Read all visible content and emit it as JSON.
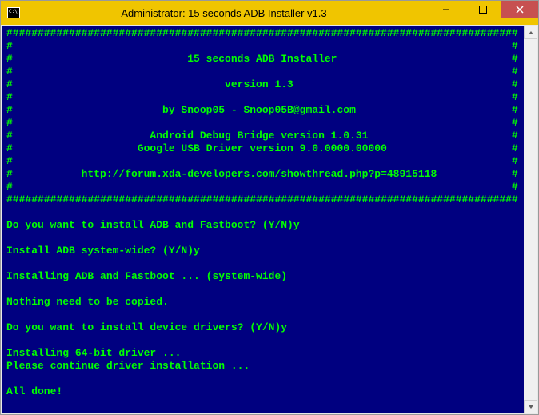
{
  "window": {
    "title": "Administrator:  15 seconds ADB Installer v1.3"
  },
  "header": {
    "hash_full": "##################################################################################",
    "hash_side": "#",
    "line_title": "15 seconds ADB Installer",
    "line_version": "version 1.3",
    "line_credit": "by Snoop05 - Snoop05B@gmail.com",
    "line_adb": "Android Debug Bridge version 1.0.31",
    "line_usb": "Google USB Driver version 9.0.0000.00000",
    "line_url": "http://forum.xda-developers.com/showthread.php?p=48915118"
  },
  "dialog": {
    "q1_prompt": "Do you want to install ADB and Fastboot? (Y/N)",
    "q1_answer": "y",
    "q2_prompt": "Install ADB system-wide? (Y/N)",
    "q2_answer": "y",
    "status1": "Installing ADB and Fastboot ... (system-wide)",
    "status2": "Nothing need to be copied.",
    "q3_prompt": "Do you want to install device drivers? (Y/N)",
    "q3_answer": "y",
    "status3": "Installing 64-bit driver ...",
    "status4": "Please continue driver installation ...",
    "done": "All done!"
  }
}
